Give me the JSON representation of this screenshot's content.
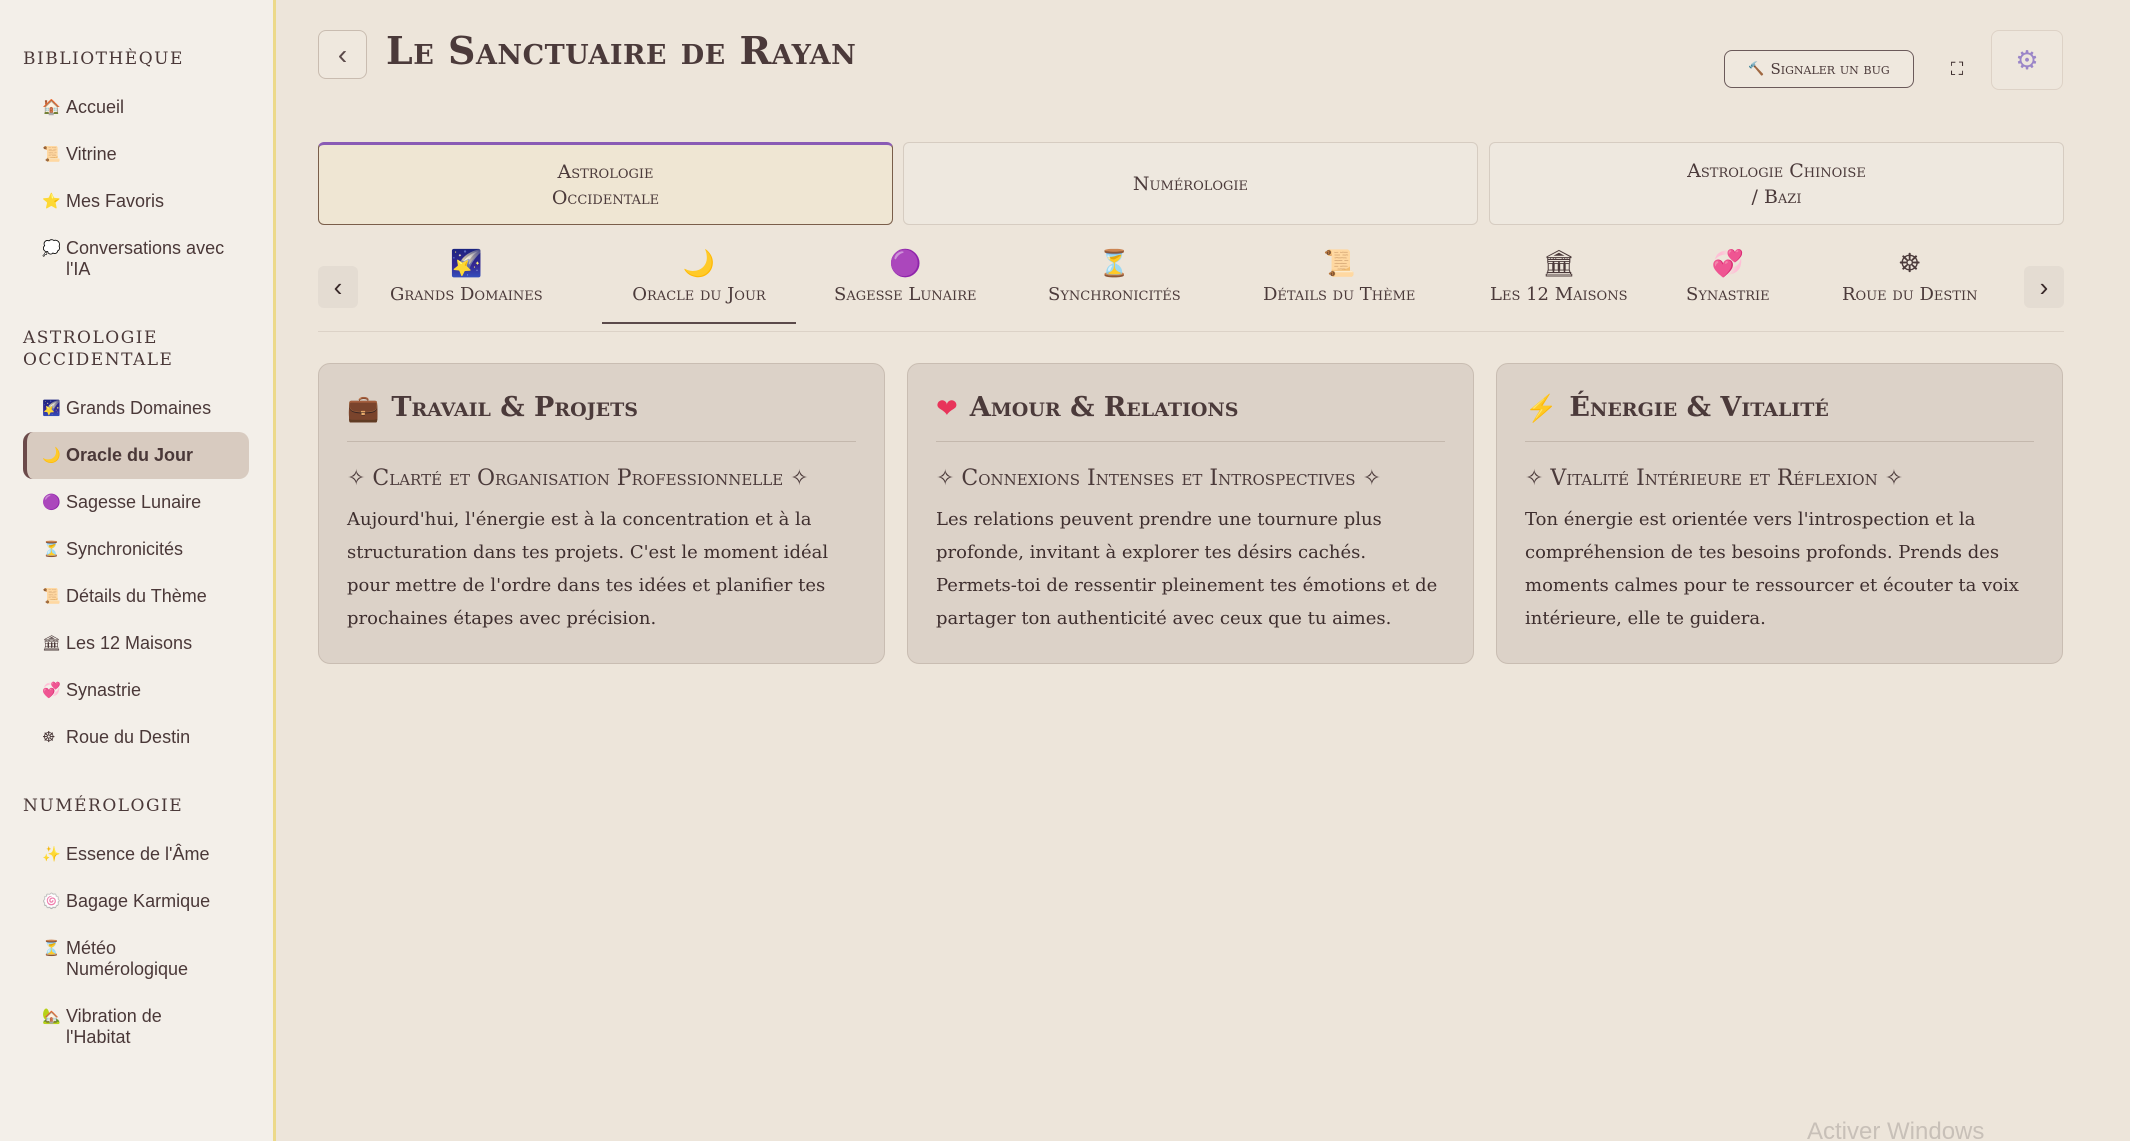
{
  "sidebar": {
    "sections": [
      {
        "title": "Bibliothèque",
        "items": [
          {
            "icon": "🏠",
            "label": "Accueil"
          },
          {
            "icon": "📜",
            "label": "Vitrine"
          },
          {
            "icon": "⭐",
            "label": "Mes Favoris"
          },
          {
            "icon": "💭",
            "label": "Conversations avec l'IA"
          }
        ]
      },
      {
        "title": "Astrologie Occidentale",
        "items": [
          {
            "icon": "🌠",
            "label": "Grands Domaines"
          },
          {
            "icon": "🌙",
            "label": "Oracle du Jour"
          },
          {
            "icon": "🟣",
            "label": "Sagesse Lunaire"
          },
          {
            "icon": "⏳",
            "label": "Synchronicités"
          },
          {
            "icon": "📜",
            "label": "Détails du Thème"
          },
          {
            "icon": "🏛",
            "label": "Les 12 Maisons"
          },
          {
            "icon": "💞",
            "label": "Synastrie"
          },
          {
            "icon": "☸",
            "label": "Roue du Destin"
          }
        ]
      },
      {
        "title": "Numérologie",
        "items": [
          {
            "icon": "✨",
            "label": "Essence de l'Âme"
          },
          {
            "icon": "🍥",
            "label": "Bagage Karmique"
          },
          {
            "icon": "⏳",
            "label": "Météo Numérologique"
          },
          {
            "icon": "🏡",
            "label": "Vibration de l'Habitat"
          }
        ]
      }
    ]
  },
  "header": {
    "back_icon": "‹",
    "title": "Le Sanctuaire de Rayan",
    "bug_icon": "🔨",
    "bug_label": "Signaler un bug",
    "fullscreen_icon": "⛶",
    "settings_icon": "⚙"
  },
  "categories": [
    {
      "line1": "Astrologie",
      "line2": "Occidentale"
    },
    {
      "line1": "Numérologie",
      "line2": ""
    },
    {
      "line1": "Astrologie Chinoise",
      "line2": "/ Bazi"
    }
  ],
  "subnav": {
    "prev_icon": "‹",
    "next_icon": "›",
    "tabs": [
      {
        "icon": "🌠",
        "label": "Grands Domaines"
      },
      {
        "icon": "🌙",
        "label": "Oracle du Jour"
      },
      {
        "icon": "🟣",
        "label": "Sagesse Lunaire"
      },
      {
        "icon": "⏳",
        "label": "Synchronicités"
      },
      {
        "icon": "📜",
        "label": "Détails du Thème"
      },
      {
        "icon": "🏛",
        "label": "Les 12 Maisons"
      },
      {
        "icon": "💞",
        "label": "Synastrie"
      },
      {
        "icon": "☸",
        "label": "Roue du Destin"
      }
    ]
  },
  "cards": [
    {
      "icon": "💼",
      "title": "Travail & Projets",
      "subtitle": "✧ Clarté et Organisation Professionnelle ✧",
      "text": "Aujourd'hui, l'énergie est à la concentration et à la structuration dans tes projets. C'est le moment idéal pour mettre de l'ordre dans tes idées et planifier tes prochaines étapes avec précision."
    },
    {
      "icon": "❤",
      "title": "Amour & Relations",
      "subtitle": "✧ Connexions Intenses et Introspectives ✧",
      "text": "Les relations peuvent prendre une tournure plus profonde, invitant à explorer tes désirs cachés. Permets-toi de ressentir pleinement tes émotions et de partager ton authenticité avec ceux que tu aimes."
    },
    {
      "icon": "⚡",
      "title": "Énergie & Vitalité",
      "subtitle": "✧ Vitalité Intérieure et Réflexion ✧",
      "text": "Ton énergie est orientée vers l'introspection et la compréhension de tes besoins profonds. Prends des moments calmes pour te ressourcer et écouter ta voix intérieure, elle te guidera."
    }
  ],
  "watermark": "Activer Windows"
}
